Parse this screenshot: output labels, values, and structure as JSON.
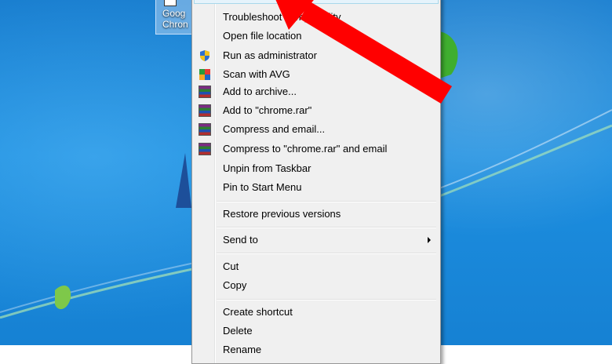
{
  "desktop_icon": {
    "label_line1": "Goog",
    "label_line2": "Chron"
  },
  "context_menu": {
    "items": [
      {
        "label": "Troubleshoot compatibility",
        "icon": "none"
      },
      {
        "label": "Open file location",
        "icon": "none"
      },
      {
        "label": "Run as administrator",
        "icon": "uac-shield-icon"
      },
      {
        "label": "Scan with AVG",
        "icon": "avg-icon"
      },
      {
        "label": "Add to archive...",
        "icon": "winrar-icon"
      },
      {
        "label": "Add to \"chrome.rar\"",
        "icon": "winrar-icon"
      },
      {
        "label": "Compress and email...",
        "icon": "winrar-icon"
      },
      {
        "label": "Compress to \"chrome.rar\" and email",
        "icon": "winrar-icon"
      },
      {
        "label": "Unpin from Taskbar",
        "icon": "none"
      },
      {
        "label": "Pin to Start Menu",
        "icon": "none"
      },
      {
        "label": "Restore previous versions",
        "icon": "none"
      },
      {
        "label": "Send to",
        "icon": "none",
        "submenu": true
      },
      {
        "label": "Cut",
        "icon": "none"
      },
      {
        "label": "Copy",
        "icon": "none"
      },
      {
        "label": "Create shortcut",
        "icon": "none"
      },
      {
        "label": "Delete",
        "icon": "none"
      },
      {
        "label": "Rename",
        "icon": "none"
      }
    ]
  },
  "colors": {
    "desktop_blue": "#1d8fe0",
    "menu_bg": "#f0f0f0",
    "annotation_arrow": "#ff0000"
  }
}
